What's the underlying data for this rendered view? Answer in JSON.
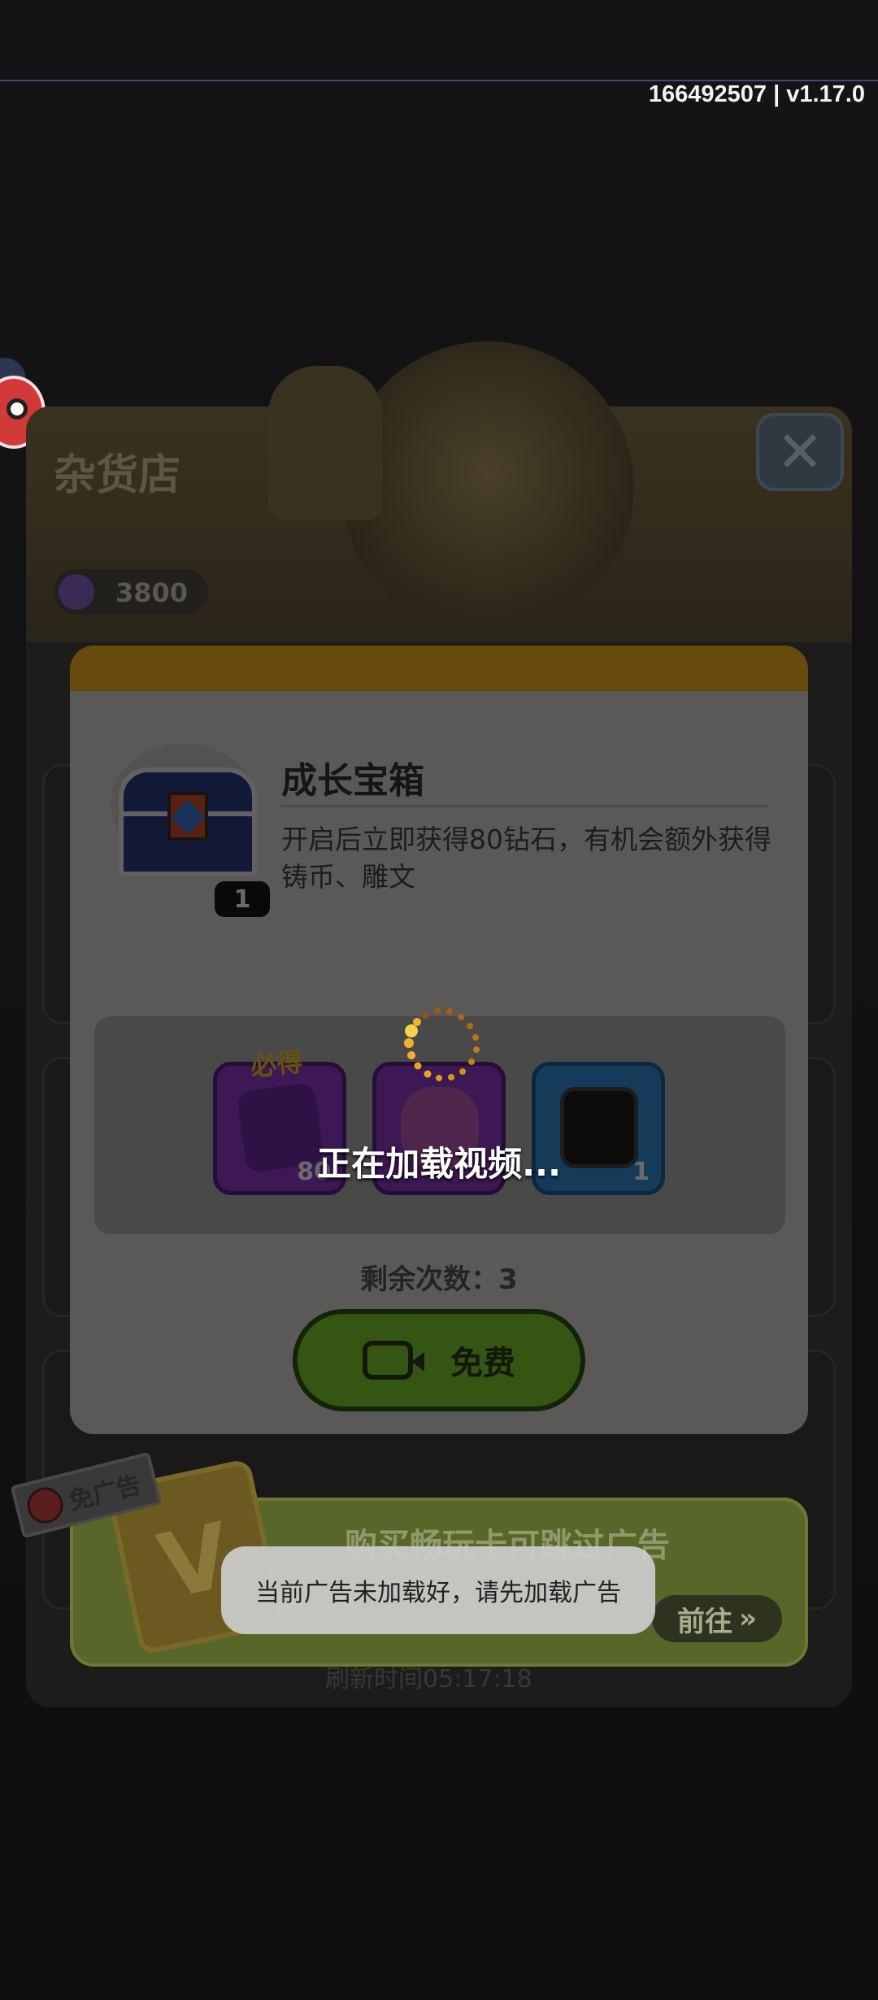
{
  "status_bar": {
    "build_id": "166492507 | v1.17.0"
  },
  "shop": {
    "title": "杂货店",
    "gem_balance": "3800",
    "refresh_time": "刷新时间05:17:18"
  },
  "ad_card": {
    "text": "购买畅玩卡可跳过广告",
    "tag_label": "免广告",
    "goto_label": "前往"
  },
  "dialog": {
    "item_name": "成长宝箱",
    "item_count": "1",
    "item_description": "开启后立即获得80钻石，有机会额外获得铸币、雕文",
    "guaranteed_label": "必得",
    "rewards": [
      {
        "name": "diamond-icon",
        "qty": "80",
        "color": "#8e38c7"
      },
      {
        "name": "coin-icon",
        "qty": "",
        "color": "#8e38c7"
      },
      {
        "name": "glyph-icon",
        "qty": "1",
        "color": "#2f8ed6"
      }
    ],
    "remaining_label": "剩余次数：3",
    "free_button_label": "免费"
  },
  "loading": {
    "text": "正在加载视频..."
  },
  "toast": {
    "text": "当前广告未加载好，请先加载广告"
  },
  "colors": {
    "header_band": "#f6b31c",
    "free_button": "#7fcc2c",
    "spinner": "#f2a21c"
  }
}
